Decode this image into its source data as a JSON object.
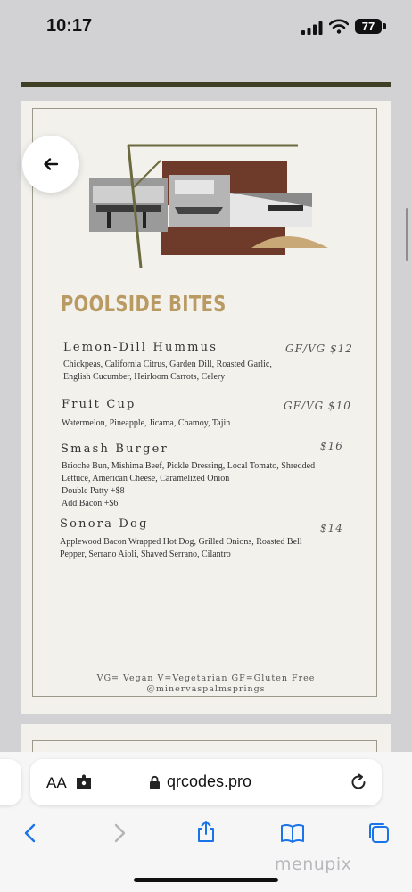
{
  "status_bar": {
    "time": "10:17",
    "battery": "77"
  },
  "menu": {
    "section_title": "POOLSIDE BITES",
    "items": [
      {
        "name": "Lemon-Dill Hummus",
        "price": "GF/VG $12",
        "description": [
          "Chickpeas, California Citrus, Garden Dill, Roasted Garlic,",
          "English Cucumber, Heirloom Carrots, Celery"
        ]
      },
      {
        "name": "Fruit Cup",
        "price": "GF/VG $10",
        "description": [
          "Watermelon, Pineapple, Jicama, Chamoy, Tajin"
        ]
      },
      {
        "name": "Smash Burger",
        "price": "$16",
        "description": [
          "Brioche Bun, Mishima Beef, Pickle Dressing, Local Tomato, Shredded",
          "Lettuce, American Cheese, Caramelized Onion",
          "Double Patty +$8",
          "Add Bacon +$6"
        ]
      },
      {
        "name": "Sonora Dog",
        "price": "$14",
        "description": [
          "Applewood Bacon Wrapped Hot Dog, Grilled Onions, Roasted Bell",
          "Pepper, Serrano Aioli, Shaved Serrano, Cilantro"
        ]
      }
    ],
    "legend": "VG= Vegan   V=Vegetarian   GF=Gluten Free",
    "handle": "@minervaspalmsprings"
  },
  "browser": {
    "text_size_label": "AA",
    "url": "qrcodes.pro"
  },
  "watermark": "menupix"
}
